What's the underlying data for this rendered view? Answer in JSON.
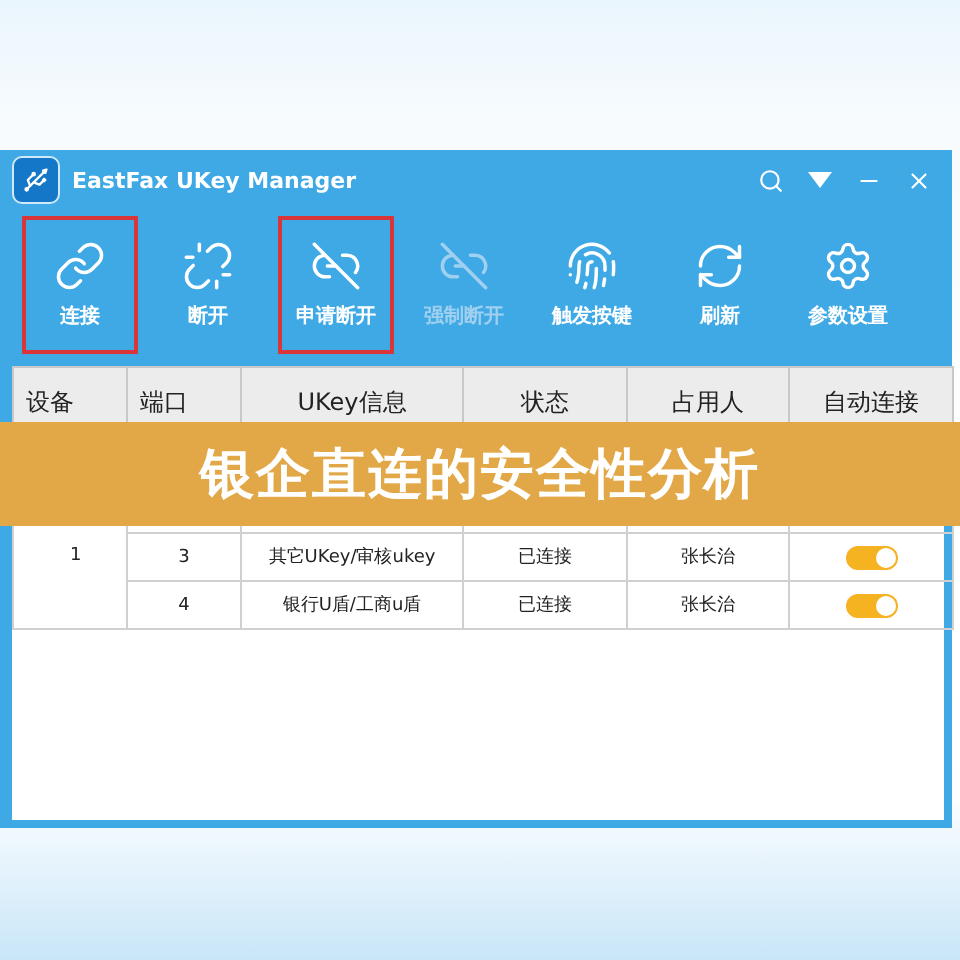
{
  "window": {
    "title": "EastFax UKey Manager"
  },
  "toolbar": [
    {
      "label": "连接",
      "highlighted": true,
      "disabled": false
    },
    {
      "label": "断开",
      "highlighted": false,
      "disabled": false
    },
    {
      "label": "申请断开",
      "highlighted": true,
      "disabled": false
    },
    {
      "label": "强制断开",
      "highlighted": false,
      "disabled": true
    },
    {
      "label": "触发按键",
      "highlighted": false,
      "disabled": false
    },
    {
      "label": "刷新",
      "highlighted": false,
      "disabled": false
    },
    {
      "label": "参数设置",
      "highlighted": false,
      "disabled": false
    }
  ],
  "table": {
    "columns": [
      "设备",
      "端口",
      "UKey信息",
      "状态",
      "占用人",
      "自动连接"
    ],
    "device": "1",
    "rows": [
      {
        "port": "3",
        "ukey": "其它UKey/审核ukey",
        "status": "已连接",
        "user": "张长治",
        "auto_connect": true
      },
      {
        "port": "4",
        "ukey": "银行U盾/工商u盾",
        "status": "已连接",
        "user": "张长治",
        "auto_connect": true
      }
    ]
  },
  "banner": {
    "title": "银企直连的安全性分析"
  }
}
